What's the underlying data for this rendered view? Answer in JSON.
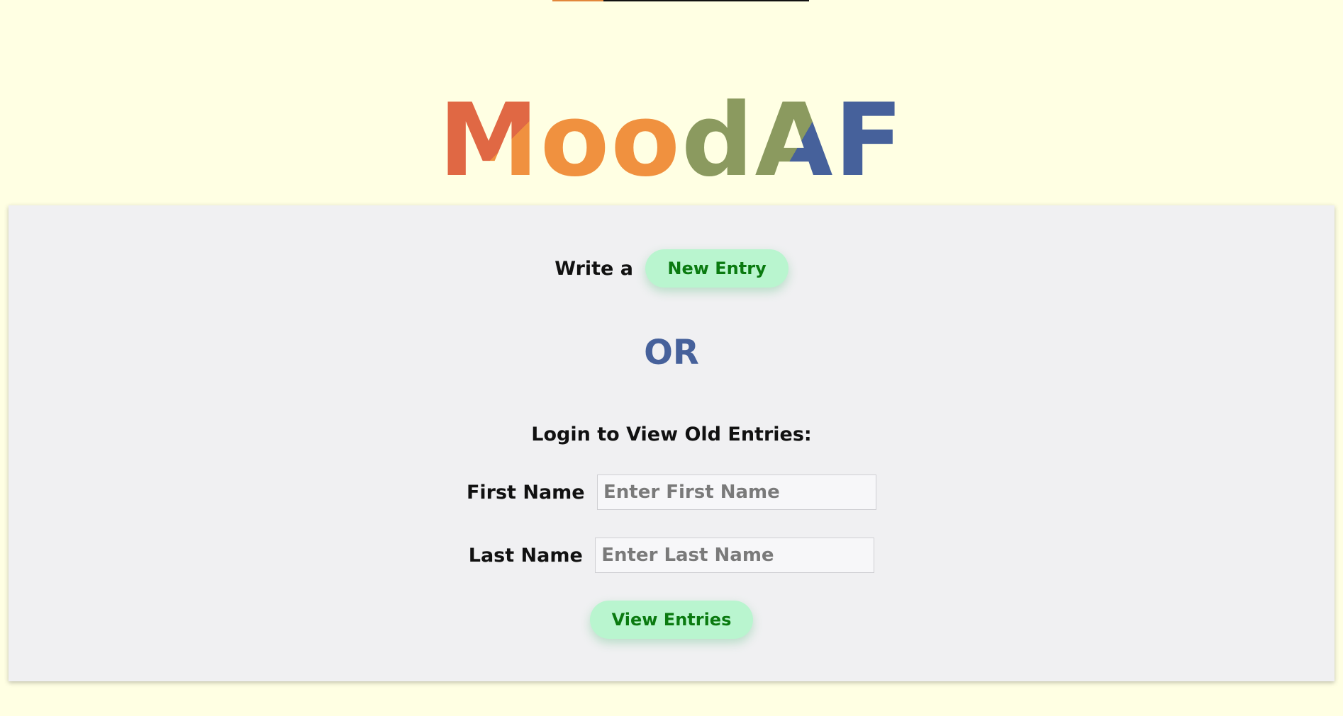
{
  "logo": {
    "letters": [
      "M",
      "o",
      "o",
      "d",
      "A",
      "F"
    ]
  },
  "colors": {
    "background": "#ffffe3",
    "panel": "#f0f0f2",
    "logo_red": "#e06844",
    "logo_orange": "#f0913f",
    "logo_olive": "#8b9a5f",
    "logo_blue": "#46619b",
    "button_bg": "#b9f5cf",
    "button_text": "#0a7a10"
  },
  "new_entry": {
    "prefix": "Write a",
    "button_label": "New Entry"
  },
  "divider_text": "OR",
  "login": {
    "title": "Login to View Old Entries:",
    "first_name_label": "First Name",
    "first_name_placeholder": "Enter First Name",
    "first_name_value": "",
    "last_name_label": "Last Name",
    "last_name_placeholder": "Enter Last Name",
    "last_name_value": "",
    "submit_label": "View Entries"
  }
}
